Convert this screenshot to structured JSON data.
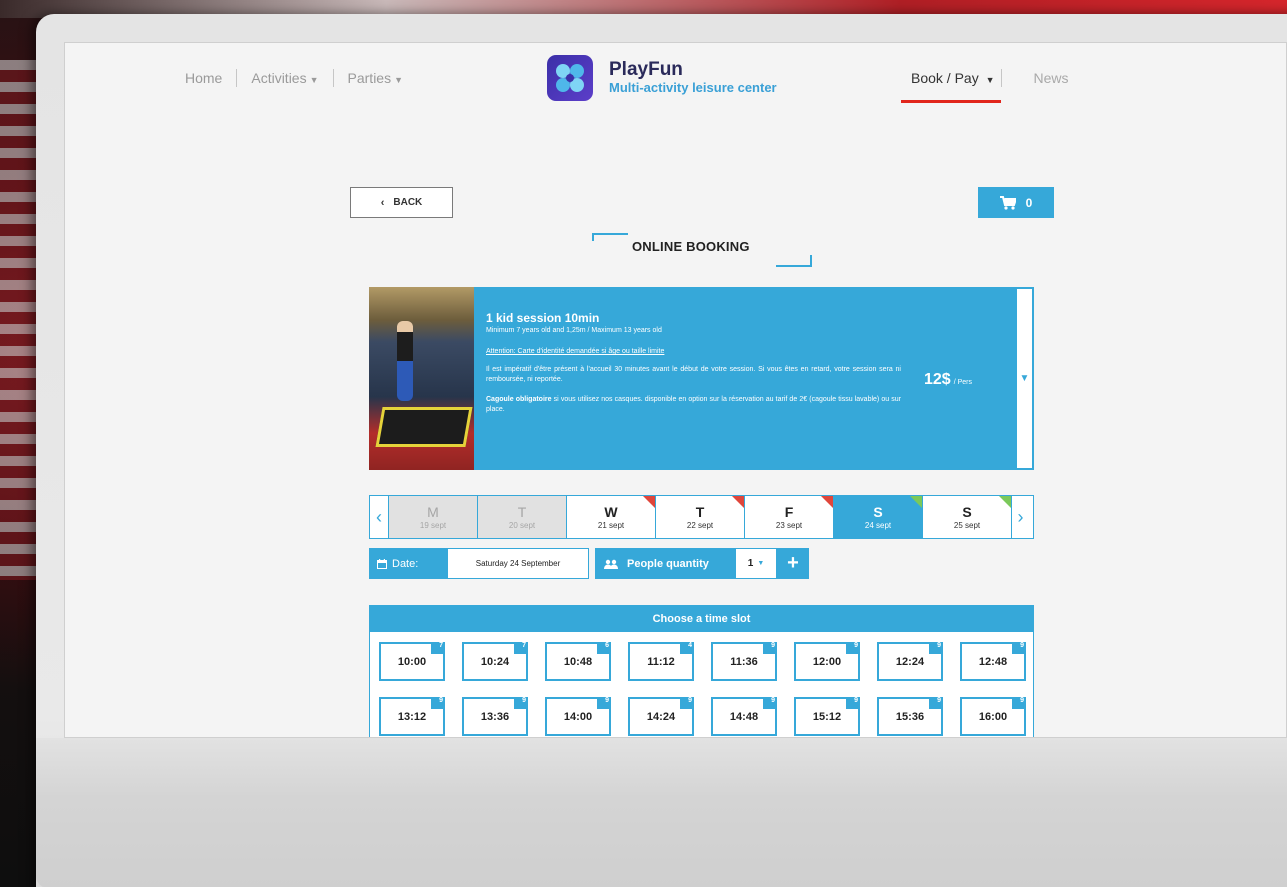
{
  "nav": {
    "items": [
      {
        "label": "Home",
        "caret": false
      },
      {
        "label": "Activities",
        "caret": true
      },
      {
        "label": "Parties",
        "caret": true
      }
    ],
    "book_label": "Book / Pay",
    "news_label": "News",
    "accent_color": "#e1261c"
  },
  "brand": {
    "name": "PlayFun",
    "tagline": "Multi-activity leisure center",
    "logo_icon": "x-logo-icon"
  },
  "controls": {
    "back_label": "BACK",
    "cart_count": "0"
  },
  "page": {
    "heading": "ONLINE BOOKING",
    "primary_color": "#36a8d9"
  },
  "activity": {
    "title": "1 kid session 10min",
    "subtitle": "Minimum 7 years old and 1,25m / Maximum 13 years old",
    "attention": "Attention: Carte d'identité demandée si âge ou taille limite",
    "paragraph1": "Il est impératif d'être présent à l'accueil 30 minutes avant le début de votre session. Si vous êtes en retard, votre session sera ni remboursée, ni reportée.",
    "paragraph2_bold": "Cagoule obligatoire",
    "paragraph2_rest": " si vous utilisez nos casques. disponible en option sur la réservation au tarif de 2€ (cagoule tissu lavable) ou sur place.",
    "price": "12$",
    "price_unit": "/ Pers"
  },
  "days": [
    {
      "letter": "M",
      "date": "19 sept",
      "state": "disabled",
      "flag": ""
    },
    {
      "letter": "T",
      "date": "20 sept",
      "state": "disabled",
      "flag": ""
    },
    {
      "letter": "W",
      "date": "21 sept",
      "state": "normal",
      "flag": "red"
    },
    {
      "letter": "T",
      "date": "22 sept",
      "state": "normal",
      "flag": "red"
    },
    {
      "letter": "F",
      "date": "23 sept",
      "state": "normal",
      "flag": "red"
    },
    {
      "letter": "S",
      "date": "24 sept",
      "state": "selected",
      "flag": "green"
    },
    {
      "letter": "S",
      "date": "25 sept",
      "state": "normal",
      "flag": "green"
    }
  ],
  "date_field": {
    "label": "Date:",
    "value": "Saturday 24 September"
  },
  "people": {
    "label": "People quantity",
    "value": "1"
  },
  "timeslots": {
    "heading": "Choose a time slot",
    "slots": [
      {
        "time": "10:00",
        "avail": "7"
      },
      {
        "time": "10:24",
        "avail": "7"
      },
      {
        "time": "10:48",
        "avail": "6"
      },
      {
        "time": "11:12",
        "avail": "4"
      },
      {
        "time": "11:36",
        "avail": "9"
      },
      {
        "time": "12:00",
        "avail": "9"
      },
      {
        "time": "12:24",
        "avail": "9"
      },
      {
        "time": "12:48",
        "avail": "9"
      },
      {
        "time": "13:12",
        "avail": "9"
      },
      {
        "time": "13:36",
        "avail": "9"
      },
      {
        "time": "14:00",
        "avail": "9"
      },
      {
        "time": "14:24",
        "avail": "9"
      },
      {
        "time": "14:48",
        "avail": "9"
      },
      {
        "time": "15:12",
        "avail": "9"
      },
      {
        "time": "15:36",
        "avail": "9"
      },
      {
        "time": "16:00",
        "avail": "9"
      }
    ]
  }
}
